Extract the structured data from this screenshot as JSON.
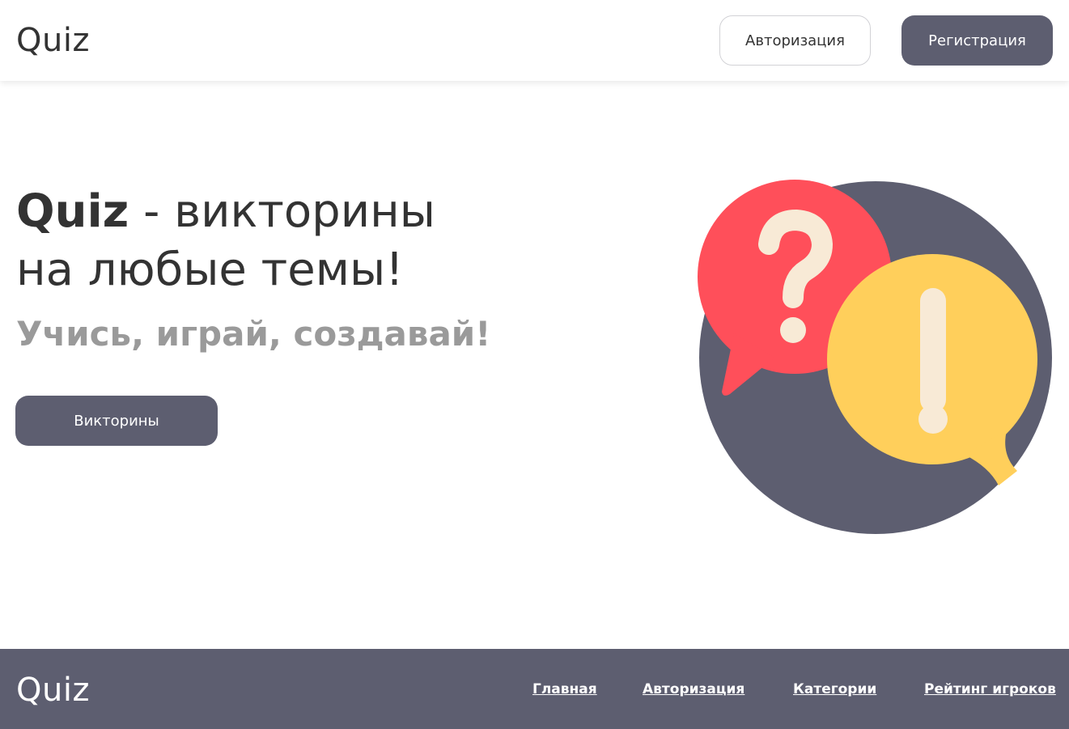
{
  "header": {
    "logo": "Quiz",
    "login_label": "Авторизация",
    "register_label": "Регистрация"
  },
  "hero": {
    "title_brand": "Quiz",
    "title_rest_line1": " - викторины",
    "title_line2": "на любые темы!",
    "slogan": "Учись, играй, создавай!",
    "cta_label": "Викторины",
    "illustration_icons": [
      "question-mark-bubble-icon",
      "exclamation-mark-bubble-icon"
    ]
  },
  "footer": {
    "logo": "Quiz",
    "links": [
      {
        "label": "Главная"
      },
      {
        "label": "Авторизация"
      },
      {
        "label": "Категории"
      },
      {
        "label": "Рейтинг игроков"
      }
    ]
  },
  "colors": {
    "primary": "#5d5e70",
    "text": "#333333",
    "slogan": "#9a9a9a",
    "bubble_red": "#ff4f5a",
    "bubble_yellow": "#ffcf5b",
    "glyph": "#f8ead6"
  }
}
